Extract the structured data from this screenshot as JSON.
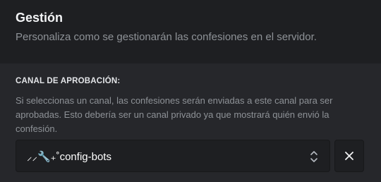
{
  "header": {
    "title": "Gestión",
    "subtitle": "Personaliza como se gestionarán las confesiones en el servidor."
  },
  "approval_channel": {
    "label": "CANAL DE APROBACIÓN:",
    "description": "Si seleccionas un canal, las confesiones serán enviadas a este canal para ser aprobadas. Esto debería ser un canal privado ya que mostrará quién envió la confesión.",
    "selected_value": "⸝⸝🔧₊˚config-bots",
    "select_icon": "chevron-up-down-icon",
    "clear_icon": "close-icon"
  }
}
